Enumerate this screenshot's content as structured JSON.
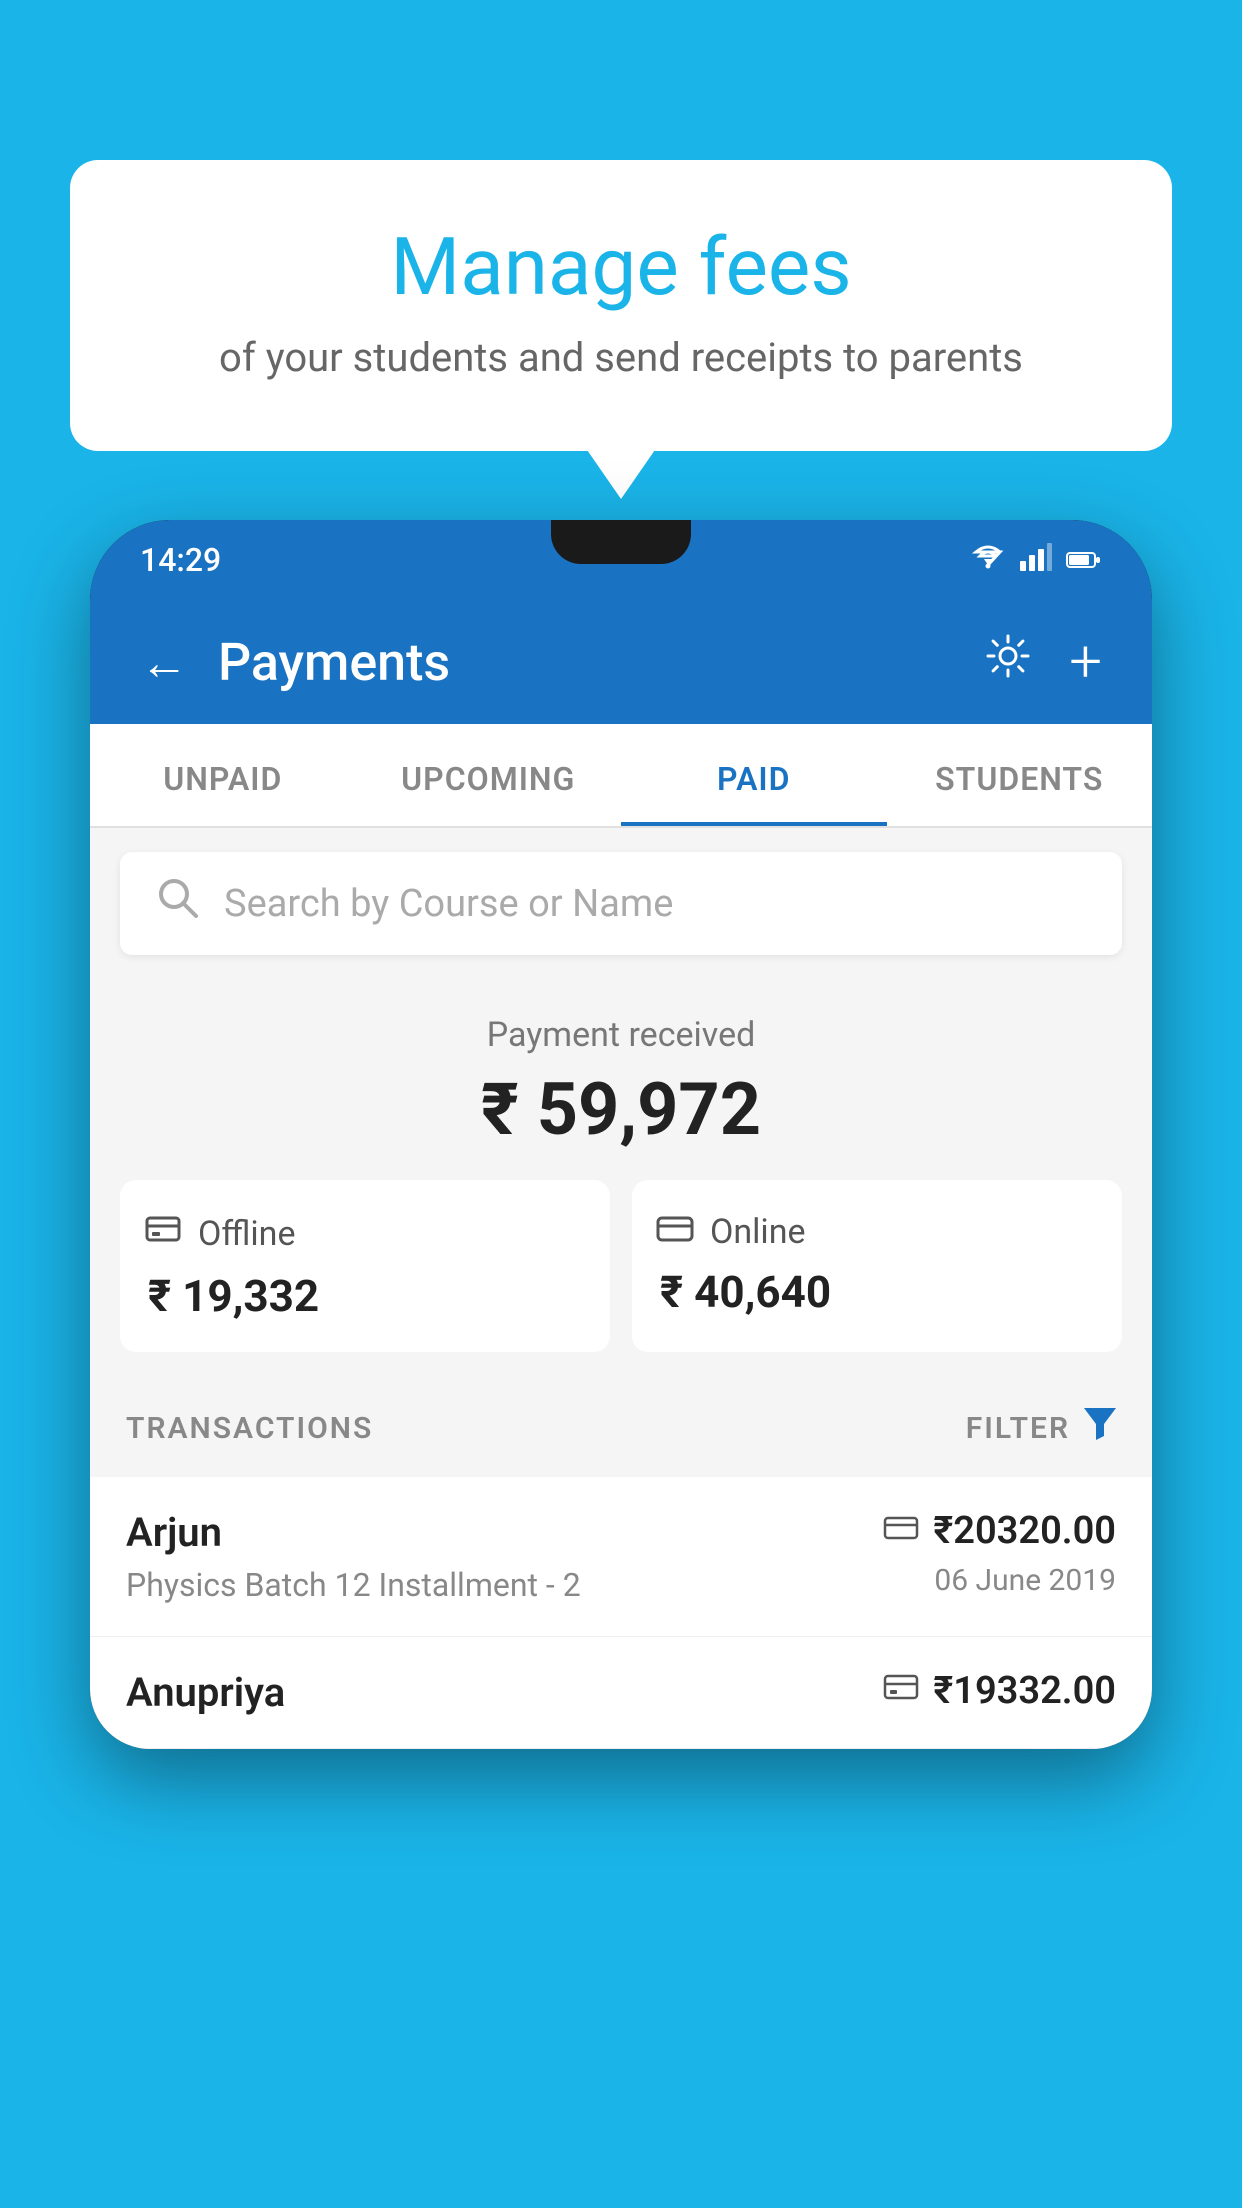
{
  "background_color": "#1ab4e8",
  "bubble": {
    "title": "Manage fees",
    "subtitle": "of your students and send receipts to parents"
  },
  "status_bar": {
    "time": "14:29",
    "icons": [
      "wifi",
      "signal",
      "battery"
    ]
  },
  "header": {
    "title": "Payments",
    "back_label": "←",
    "settings_label": "⚙",
    "add_label": "+"
  },
  "tabs": [
    {
      "label": "UNPAID",
      "active": false
    },
    {
      "label": "UPCOMING",
      "active": false
    },
    {
      "label": "PAID",
      "active": true
    },
    {
      "label": "STUDENTS",
      "active": false
    }
  ],
  "search": {
    "placeholder": "Search by Course or Name"
  },
  "payment_summary": {
    "received_label": "Payment received",
    "total_amount": "₹ 59,972",
    "offline": {
      "label": "Offline",
      "amount": "₹ 19,332"
    },
    "online": {
      "label": "Online",
      "amount": "₹ 40,640"
    }
  },
  "transactions": {
    "section_label": "TRANSACTIONS",
    "filter_label": "FILTER",
    "items": [
      {
        "name": "Arjun",
        "course": "Physics Batch 12 Installment - 2",
        "payment_type": "card",
        "amount": "₹20320.00",
        "date": "06 June 2019"
      },
      {
        "name": "Anupriya",
        "course": "",
        "payment_type": "offline",
        "amount": "₹19332.00",
        "date": ""
      }
    ]
  }
}
